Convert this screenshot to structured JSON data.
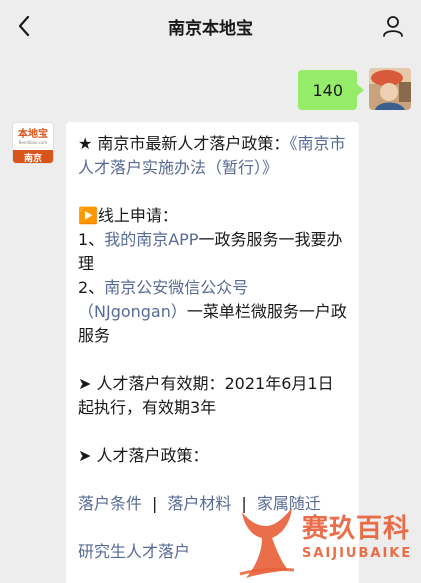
{
  "header": {
    "title": "南京本地宝"
  },
  "outgoing": {
    "text": "140"
  },
  "bot": {
    "avatar_logo": "本地宝",
    "avatar_sub": "Bendibao.com",
    "avatar_city": "南京"
  },
  "message": {
    "policy_prefix": "★ 南京市最新人才落户政策：",
    "policy_link": "《南京市人才落户实施办法（暂行）》",
    "online_heading": "▶️线上申请：",
    "item1_prefix": "1、",
    "item1_link": "我的南京APP",
    "item1_suffix": "一政务服务一我要办理",
    "item2_prefix": "2、",
    "item2_link": "南京公安微信公众号（NJgongan）",
    "item2_suffix": "一菜单栏微服务一户政服务",
    "validity_arrow": "➤",
    "validity_text": " 人才落户有效期：2021年6月1日起执行，有效期3年",
    "policy_arrow": "➤",
    "policy_heading": " 人才落户政策：",
    "link_conditions": "落户条件",
    "link_materials": "落户材料",
    "link_family": "家属随迁",
    "separator": "|",
    "link_graduate": "研究生人才落户"
  },
  "watermark": {
    "title": "赛玖百科",
    "subtitle": "SAIJIUBAIKE"
  },
  "colors": {
    "out_bubble": "#95ec69",
    "link": "#576b95",
    "brand": "#d9541a"
  }
}
